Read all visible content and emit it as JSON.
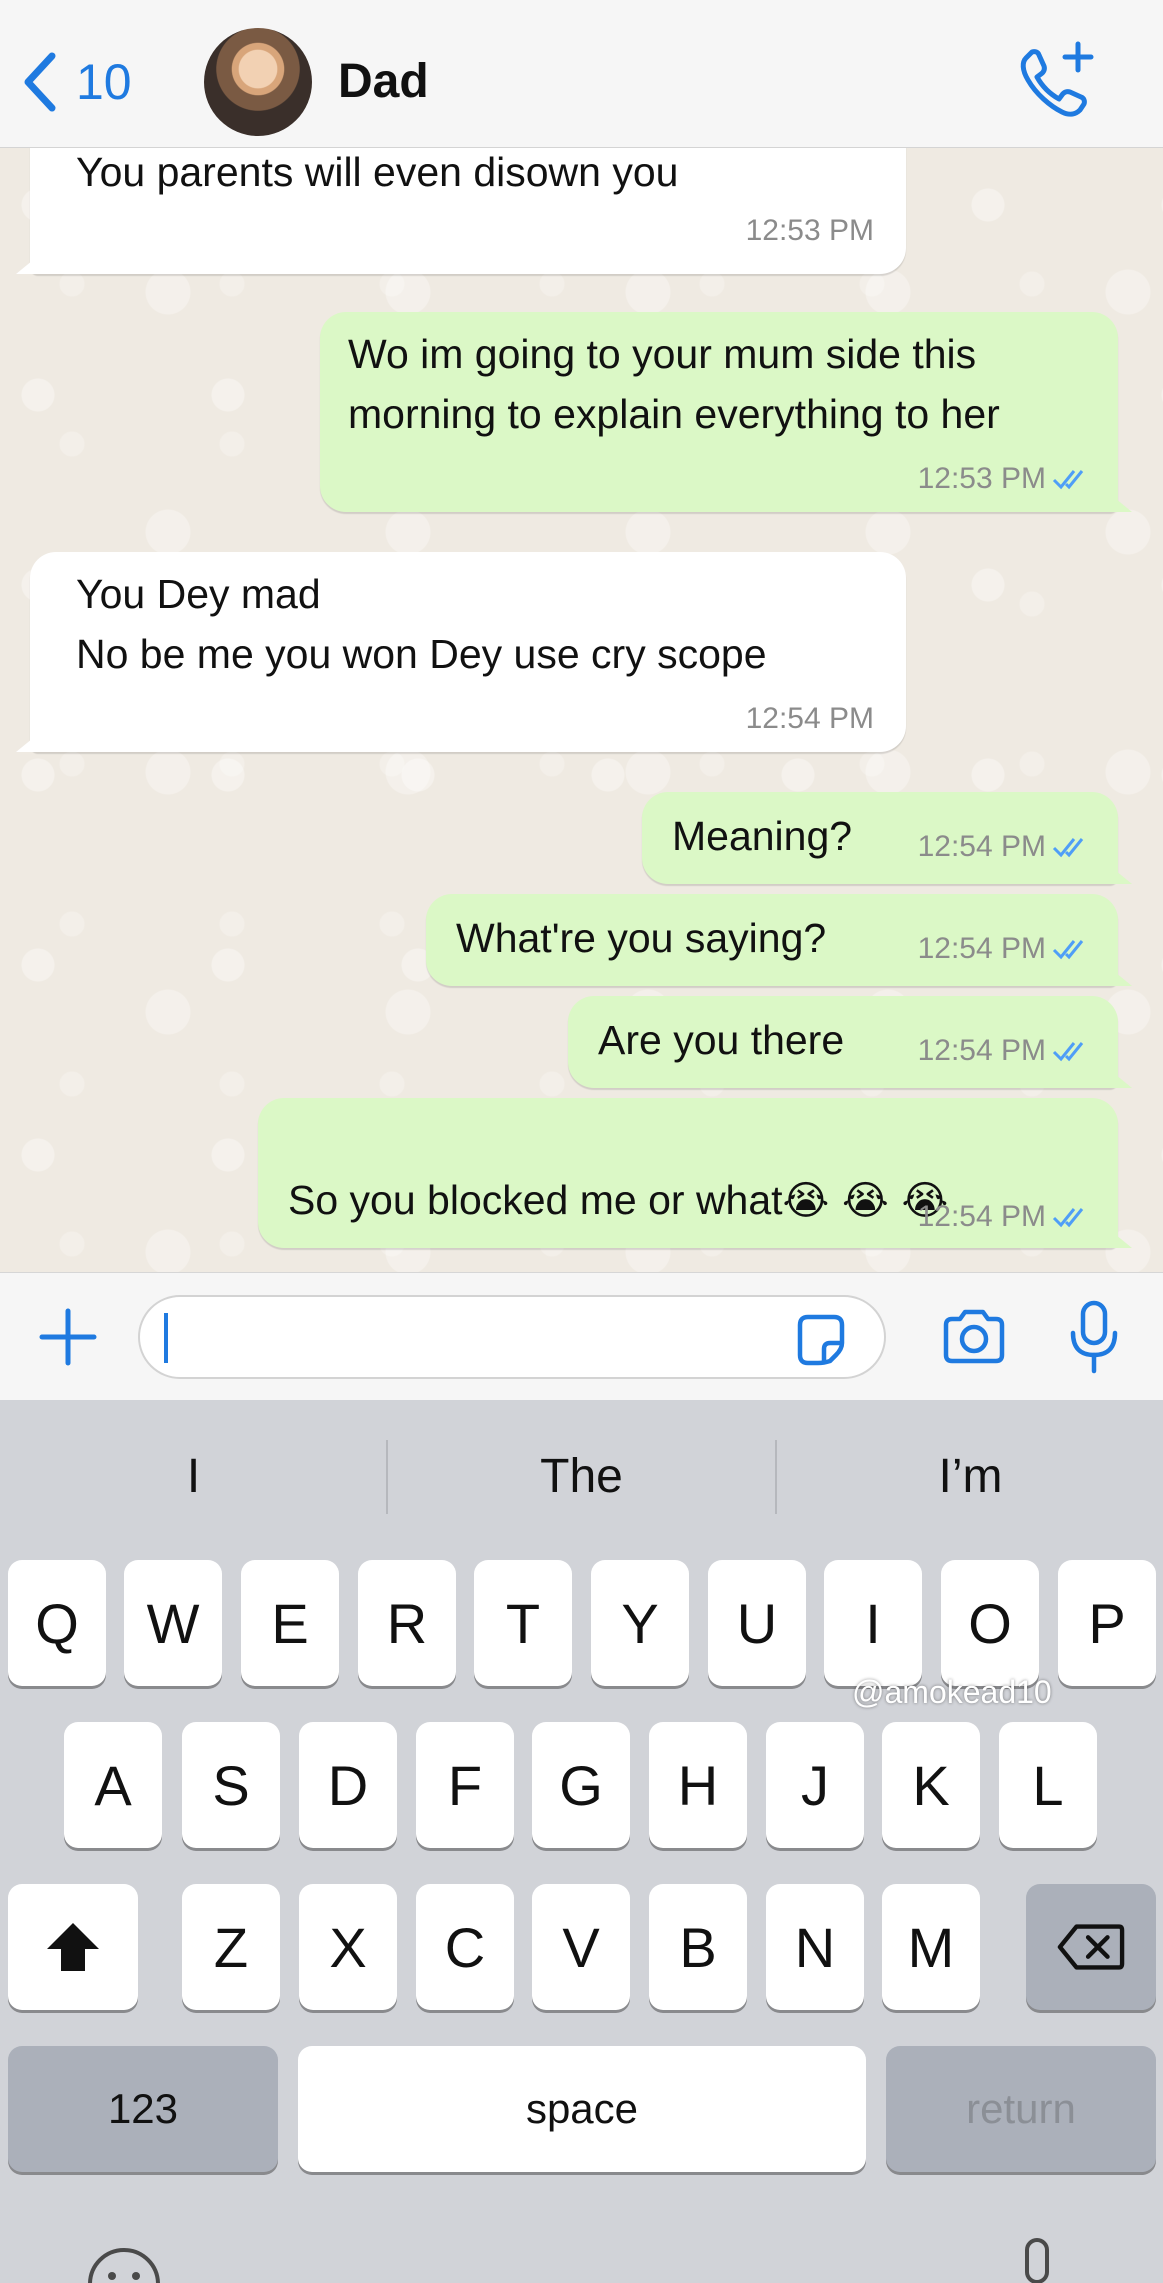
{
  "header": {
    "back_count": "10",
    "contact_name": "Dad"
  },
  "messages": [
    {
      "direction": "in",
      "text": "You parents will even disown you",
      "time": "12:53 PM"
    },
    {
      "direction": "out",
      "text": "Wo im going to your mum side this\nmorning to explain everything to her",
      "time": "12:53 PM",
      "status": "read"
    },
    {
      "direction": "in",
      "text": "You Dey mad\nNo be me you won Dey use cry scope",
      "time": "12:54 PM"
    },
    {
      "direction": "out",
      "text": "Meaning?",
      "time": "12:54 PM",
      "status": "read"
    },
    {
      "direction": "out",
      "text": "What're you saying?",
      "time": "12:54 PM",
      "status": "read"
    },
    {
      "direction": "out",
      "text": "Are you there",
      "time": "12:54 PM",
      "status": "read"
    },
    {
      "direction": "out",
      "text": "So you blocked me or what",
      "emoji": "😭 😭 😭",
      "emoji2": "😭",
      "time": "12:54 PM",
      "status": "read"
    }
  ],
  "input": {
    "value": ""
  },
  "keyboard": {
    "suggestions": [
      "I",
      "The",
      "I’m"
    ],
    "row1": [
      "Q",
      "W",
      "E",
      "R",
      "T",
      "Y",
      "U",
      "I",
      "O",
      "P"
    ],
    "row2": [
      "A",
      "S",
      "D",
      "F",
      "G",
      "H",
      "J",
      "K",
      "L"
    ],
    "row3": [
      "Z",
      "X",
      "C",
      "V",
      "B",
      "N",
      "M"
    ],
    "numbers_label": "123",
    "space_label": "space",
    "return_label": "return"
  },
  "watermark": "@amokead10",
  "icons": {
    "back": "chevron-left-icon",
    "call": "phone-add-icon",
    "plus": "plus-icon",
    "sticker": "sticker-icon",
    "camera": "camera-icon",
    "mic": "microphone-icon",
    "read_ticks": "double-check-icon",
    "shift": "shift-icon",
    "delete": "backspace-icon",
    "emoji": "emoji-icon",
    "dictation": "microphone-icon"
  },
  "colors": {
    "accent": "#1f7ae0",
    "outgoing_bubble": "#dbf8c6",
    "incoming_bubble": "#ffffff",
    "chat_background": "#efeae2",
    "keyboard_background": "#d1d3d8"
  }
}
